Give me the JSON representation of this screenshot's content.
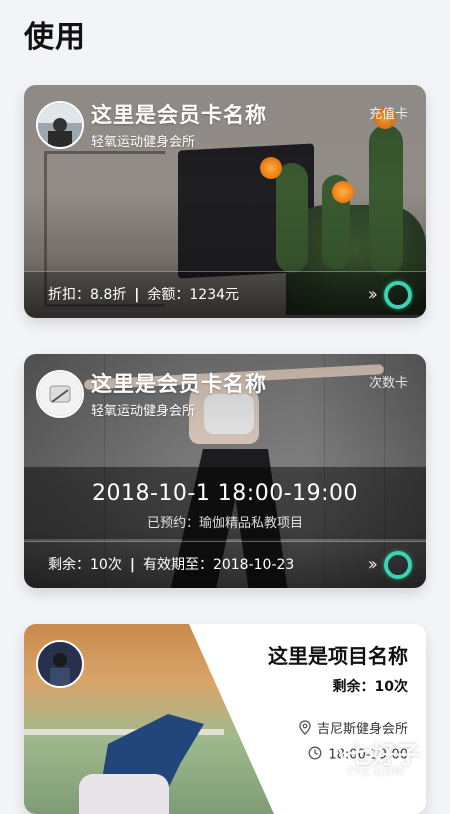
{
  "page": {
    "title": "使用"
  },
  "cards": [
    {
      "name": "这里是会员卡名称",
      "gym": "轻氧运动健身会所",
      "type": "充值卡",
      "discount_label": "折扣：",
      "discount_value": "8.8折",
      "separator": "|",
      "balance_label": "余额：",
      "balance_value": "1234元"
    },
    {
      "name": "这里是会员卡名称",
      "gym": "轻氧运动健身会所",
      "type": "次数卡",
      "booking_datetime": "2018-10-1  18:00-19:00",
      "booking_status": "已预约：瑜伽精品私教项目",
      "remain_label": "剩余：",
      "remain_value": "10次",
      "separator": "|",
      "valid_label": "有效期至：",
      "valid_value": "2018-10-23"
    }
  ],
  "project": {
    "name": "这里是项目名称",
    "remain": "剩余：10次",
    "gym": "吉尼斯健身会所",
    "time": "18:00-19:00"
  },
  "watermark": {
    "text": "七好子",
    "url": "7YZ.COM"
  },
  "icons": {
    "more": "double-chevron-right-icon",
    "status": "ring-icon",
    "location": "location-pin-icon",
    "clock": "clock-icon"
  },
  "colors": {
    "accent": "#37d6b3"
  }
}
